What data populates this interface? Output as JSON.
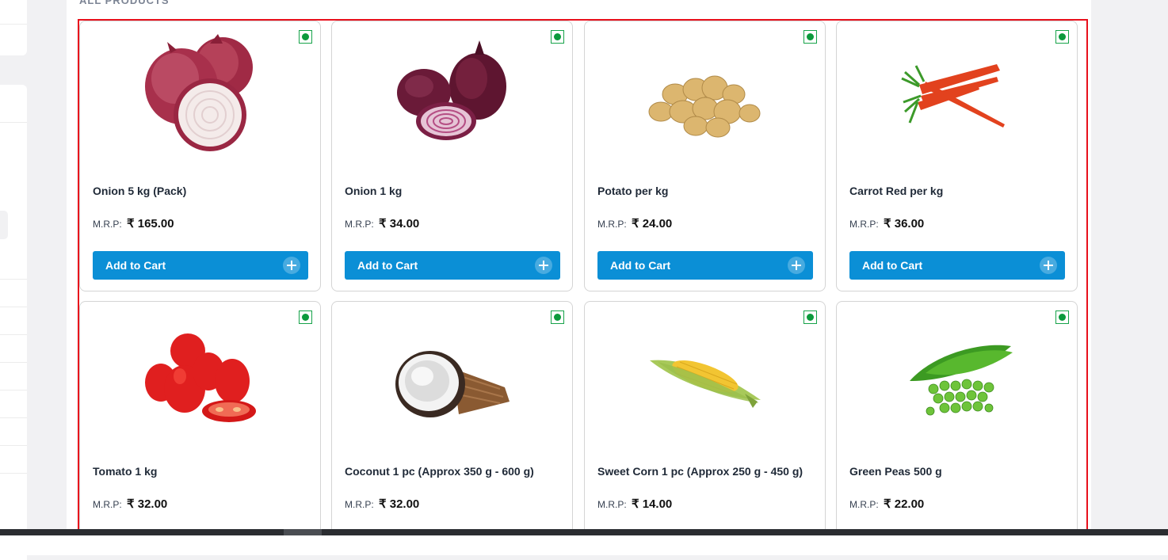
{
  "section": {
    "title": "ALL PRODUCTS"
  },
  "currency": "₹",
  "mrp_label": "M.R.P:",
  "add_to_cart_label": "Add to Cart",
  "products": [
    {
      "name": "Onion 5 kg (Pack)",
      "price": "₹ 165.00",
      "icon": "onion-image"
    },
    {
      "name": "Onion 1 kg",
      "price": "₹ 34.00",
      "icon": "red-onion-image"
    },
    {
      "name": "Potato per kg",
      "price": "₹ 24.00",
      "icon": "potato-image"
    },
    {
      "name": "Carrot Red per kg",
      "price": "₹ 36.00",
      "icon": "carrot-image"
    },
    {
      "name": "Tomato 1 kg",
      "price": "₹ 32.00",
      "icon": "tomato-image"
    },
    {
      "name": "Coconut 1 pc (Approx 350 g - 600 g)",
      "price": "₹ 32.00",
      "icon": "coconut-image"
    },
    {
      "name": "Sweet Corn 1 pc (Approx 250 g - 450 g)",
      "price": "₹ 14.00",
      "icon": "sweet-corn-image"
    },
    {
      "name": "Green Peas 500 g",
      "price": "₹ 22.00",
      "icon": "green-peas-image"
    }
  ],
  "colors": {
    "button": "#0b8fd6",
    "veg_mark": "#0b9a3c",
    "highlight": "#e8101c"
  }
}
